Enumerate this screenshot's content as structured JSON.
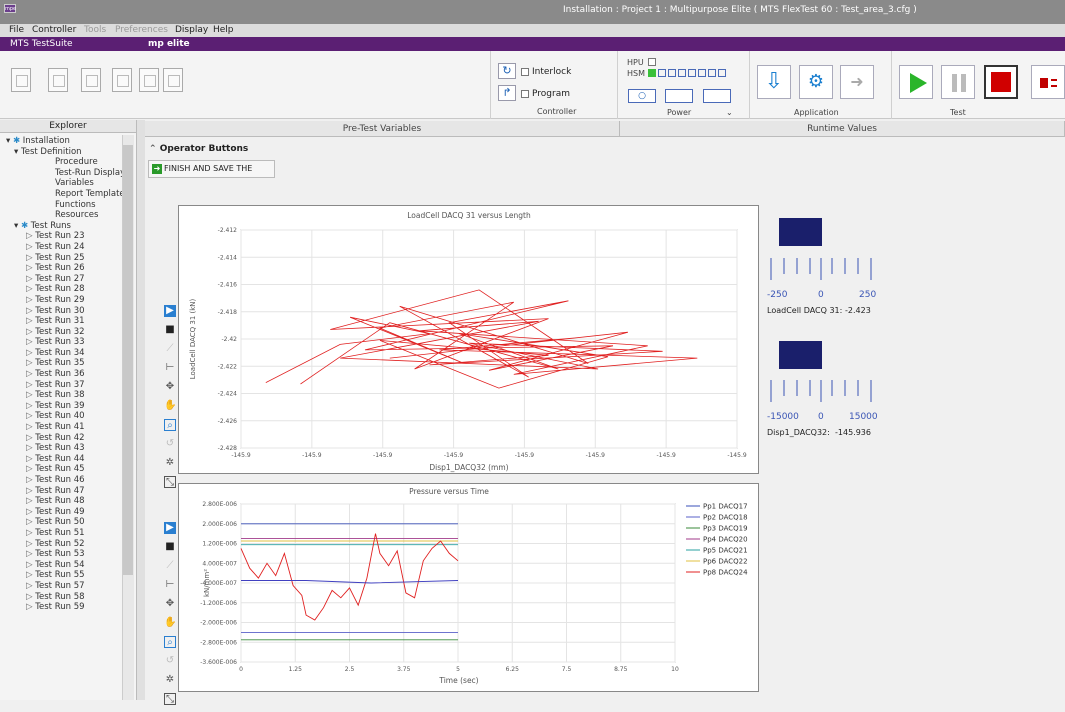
{
  "window": {
    "title": "Installation : Project 1 : Multipurpose Elite ( MTS FlexTest 60 : Test_area_3.cfg )",
    "logo_text": "mpe"
  },
  "menu": {
    "items": [
      "File",
      "Controller",
      "Tools",
      "Preferences",
      "Display",
      "Help"
    ]
  },
  "brand": {
    "product": "MTS TestSuite",
    "badge": "mp elite"
  },
  "toolbar": {
    "interlock_label": "Interlock",
    "program_label": "Program",
    "controller_group": "Controller",
    "hpu_label": "HPU",
    "hsm_label": "HSM",
    "power_group": "Power",
    "application_group": "Application",
    "test_group": "Test"
  },
  "explorer": {
    "header": "Explorer",
    "tree": [
      {
        "label": "Installation",
        "level": 0
      },
      {
        "label": "Test Definition",
        "level": 1
      },
      {
        "label": "Procedure",
        "level": 2
      },
      {
        "label": "Test-Run Display",
        "level": 2
      },
      {
        "label": "Variables",
        "level": 2
      },
      {
        "label": "Report Templates",
        "level": 2
      },
      {
        "label": "Functions",
        "level": 2
      },
      {
        "label": "Resources",
        "level": 2
      },
      {
        "label": "Test Runs",
        "level": 1
      },
      {
        "label": "Test Run 23",
        "level": 2
      },
      {
        "label": "Test Run 24",
        "level": 2
      },
      {
        "label": "Test Run 25",
        "level": 2
      },
      {
        "label": "Test Run 26",
        "level": 2
      },
      {
        "label": "Test Run 27",
        "level": 2
      },
      {
        "label": "Test Run 28",
        "level": 2
      },
      {
        "label": "Test Run 29",
        "level": 2
      },
      {
        "label": "Test Run 30",
        "level": 2
      },
      {
        "label": "Test Run 31",
        "level": 2
      },
      {
        "label": "Test Run 32",
        "level": 2
      },
      {
        "label": "Test Run 33",
        "level": 2
      },
      {
        "label": "Test Run 34",
        "level": 2
      },
      {
        "label": "Test Run 35",
        "level": 2
      },
      {
        "label": "Test Run 36",
        "level": 2
      },
      {
        "label": "Test Run 37",
        "level": 2
      },
      {
        "label": "Test Run 38",
        "level": 2
      },
      {
        "label": "Test Run 39",
        "level": 2
      },
      {
        "label": "Test Run 40",
        "level": 2
      },
      {
        "label": "Test Run 41",
        "level": 2
      },
      {
        "label": "Test Run 42",
        "level": 2
      },
      {
        "label": "Test Run 43",
        "level": 2
      },
      {
        "label": "Test Run 44",
        "level": 2
      },
      {
        "label": "Test Run 45",
        "level": 2
      },
      {
        "label": "Test Run 46",
        "level": 2
      },
      {
        "label": "Test Run 47",
        "level": 2
      },
      {
        "label": "Test Run 48",
        "level": 2
      },
      {
        "label": "Test Run 49",
        "level": 2
      },
      {
        "label": "Test Run 50",
        "level": 2
      },
      {
        "label": "Test Run 51",
        "level": 2
      },
      {
        "label": "Test Run 52",
        "level": 2
      },
      {
        "label": "Test Run 53",
        "level": 2
      },
      {
        "label": "Test Run 54",
        "level": 2
      },
      {
        "label": "Test Run 55",
        "level": 2
      },
      {
        "label": "Test Run 57",
        "level": 2
      },
      {
        "label": "Test Run 58",
        "level": 2
      },
      {
        "label": "Test Run 59",
        "level": 2
      }
    ]
  },
  "tabs": {
    "pretest": "Pre-Test Variables",
    "runtime": "Runtime Values"
  },
  "operator": {
    "section": "Operator Buttons",
    "finish_button": "FINISH AND SAVE THE TEST"
  },
  "meters": [
    {
      "min": "-250",
      "mid": "0",
      "max": "250",
      "label": "LoadCell DACQ 31:",
      "value": "-2.423"
    },
    {
      "min": "-15000",
      "mid": "0",
      "max": "15000",
      "label": "Disp1_DACQ32:",
      "value": "-145.936"
    }
  ],
  "chart_data": [
    {
      "type": "line",
      "title": "LoadCell DACQ 31 versus Length",
      "xlabel": "Disp1_DACQ32 (mm)",
      "ylabel": "LoadCell DACQ 31 (kN)",
      "xticks": [
        "-145.9",
        "-145.9",
        "-145.9",
        "-145.9",
        "-145.9",
        "-145.9",
        "-145.9",
        "-145.9"
      ],
      "yticks": [
        "-2.412",
        "-2.414",
        "-2.416",
        "-2.418",
        "-2.42",
        "-2.422",
        "-2.424",
        "-2.426",
        "-2.428"
      ],
      "ylim": [
        -2.428,
        -2.412
      ],
      "grid": true,
      "series": [
        {
          "color": "#e02020",
          "points": [
            [
              0.05,
              -2.4232
            ],
            [
              0.2,
              -2.4204
            ],
            [
              0.38,
              -2.4196
            ],
            [
              0.22,
              -2.4184
            ],
            [
              0.45,
              -2.4218
            ],
            [
              0.28,
              -2.4192
            ],
            [
              0.55,
              -2.4173
            ],
            [
              0.35,
              -2.4222
            ],
            [
              0.62,
              -2.4185
            ],
            [
              0.18,
              -2.4193
            ],
            [
              0.48,
              -2.4164
            ],
            [
              0.7,
              -2.4218
            ],
            [
              0.32,
              -2.4176
            ],
            [
              0.58,
              -2.4228
            ],
            [
              0.42,
              -2.4188
            ],
            [
              0.66,
              -2.4172
            ],
            [
              0.25,
              -2.4208
            ],
            [
              0.75,
              -2.4205
            ],
            [
              0.5,
              -2.4223
            ],
            [
              0.78,
              -2.4195
            ],
            [
              0.3,
              -2.4214
            ],
            [
              0.68,
              -2.4199
            ],
            [
              0.4,
              -2.4208
            ],
            [
              0.92,
              -2.4214
            ],
            [
              0.55,
              -2.4226
            ],
            [
              0.82,
              -2.4205
            ],
            [
              0.36,
              -2.4194
            ],
            [
              0.6,
              -2.4187
            ],
            [
              0.2,
              -2.4214
            ],
            [
              0.72,
              -2.4222
            ],
            [
              0.46,
              -2.4203
            ],
            [
              0.85,
              -2.4209
            ],
            [
              0.38,
              -2.4219
            ],
            [
              0.62,
              -2.4212
            ],
            [
              0.28,
              -2.4201
            ],
            [
              0.52,
              -2.4236
            ],
            [
              0.74,
              -2.4213
            ],
            [
              0.44,
              -2.4196
            ],
            [
              0.64,
              -2.4222
            ],
            [
              0.3,
              -2.4188
            ],
            [
              0.12,
              -2.4233
            ]
          ]
        }
      ]
    },
    {
      "type": "line",
      "title": "Pressure versus Time",
      "xlabel": "Time (sec)",
      "ylabel": "kN/mm²",
      "xticks": [
        "0",
        "1.25",
        "2.5",
        "3.75",
        "5",
        "6.25",
        "7.5",
        "8.75",
        "10"
      ],
      "yticks": [
        "2.800E-006",
        "2.000E-006",
        "1.200E-006",
        "4.000E-007",
        "-4.000E-007",
        "-1.200E-006",
        "-2.000E-006",
        "-2.800E-006",
        "-3.600E-006"
      ],
      "xlim": [
        0,
        10
      ],
      "ylim": [
        -3.6e-06,
        2.8e-06
      ],
      "grid": true,
      "series": [
        {
          "name": "Pp1 DACQ17",
          "color": "#3a4fb8",
          "values": [
            [
              0,
              2e-06
            ],
            [
              5,
              2e-06
            ]
          ]
        },
        {
          "name": "Pp2 DACQ18",
          "color": "#5a60c8",
          "values": [
            [
              0,
              -2.4e-06
            ],
            [
              5,
              -2.4e-06
            ]
          ]
        },
        {
          "name": "Pp3 DACQ19",
          "color": "#3a8a3a",
          "values": [
            [
              0,
              -2.7e-06
            ],
            [
              5,
              -2.7e-06
            ]
          ]
        },
        {
          "name": "Pp4 DACQ20",
          "color": "#a03a8a",
          "values": [
            [
              0,
              1.4e-06
            ],
            [
              5,
              1.4e-06
            ]
          ]
        },
        {
          "name": "Pp5 DACQ21",
          "color": "#2aa0a0",
          "values": [
            [
              0,
              1.15e-06
            ],
            [
              5,
              1.15e-06
            ]
          ]
        },
        {
          "name": "Pp6 DACQ22",
          "color": "#e0c040",
          "values": [
            [
              0,
              1.3e-06
            ],
            [
              5,
              1.3e-06
            ]
          ]
        },
        {
          "name": "Pp8 DACQ24",
          "color": "#e02020",
          "values": [
            [
              0,
              1e-06
            ],
            [
              0.2,
              2e-07
            ],
            [
              0.4,
              -2e-07
            ],
            [
              0.6,
              4e-07
            ],
            [
              0.8,
              -1e-07
            ],
            [
              1.0,
              8e-07
            ],
            [
              1.2,
              -5e-07
            ],
            [
              1.4,
              -9e-07
            ],
            [
              1.5,
              -1.7e-06
            ],
            [
              1.7,
              -1.9e-06
            ],
            [
              1.9,
              -1.4e-06
            ],
            [
              2.1,
              -7e-07
            ],
            [
              2.3,
              -1e-06
            ],
            [
              2.5,
              -6e-07
            ],
            [
              2.7,
              -1.3e-06
            ],
            [
              2.9,
              -2e-07
            ],
            [
              3.1,
              1.6e-06
            ],
            [
              3.2,
              8e-07
            ],
            [
              3.4,
              3e-07
            ],
            [
              3.6,
              9e-07
            ],
            [
              3.8,
              -8e-07
            ],
            [
              4.0,
              -1e-06
            ],
            [
              4.2,
              5e-07
            ],
            [
              4.4,
              1e-06
            ],
            [
              4.6,
              1.3e-06
            ],
            [
              4.8,
              8e-07
            ],
            [
              5.0,
              5e-07
            ]
          ]
        },
        {
          "name": "",
          "color": "#4040c0",
          "values": [
            [
              0,
              -3e-07
            ],
            [
              1.5,
              -3e-07
            ],
            [
              3.0,
              -4e-07
            ],
            [
              5.0,
              -3e-07
            ]
          ]
        }
      ]
    }
  ]
}
